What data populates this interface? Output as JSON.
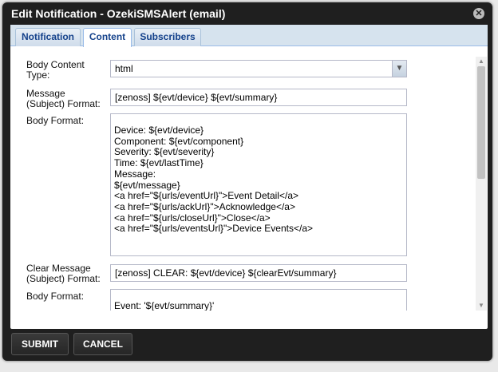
{
  "dialog": {
    "title": "Edit Notification - OzekiSMSAlert (email)",
    "close_icon": "close-icon"
  },
  "tabs": [
    {
      "label": "Notification",
      "active": false
    },
    {
      "label": "Content",
      "active": true
    },
    {
      "label": "Subscribers",
      "active": false
    }
  ],
  "form": {
    "body_content_type_label": "Body Content Type:",
    "body_content_type_value": "html",
    "message_subject_label": "Message (Subject) Format:",
    "message_subject_value": "[zenoss] ${evt/device} ${evt/summary}",
    "body_format_label": "Body Format:",
    "body_format_value": "Device: ${evt/device}\nComponent: ${evt/component}\nSeverity: ${evt/severity}\nTime: ${evt/lastTime}\nMessage:\n${evt/message}\n<a href=\"${urls/eventUrl}\">Event Detail</a>\n<a href=\"${urls/ackUrl}\">Acknowledge</a>\n<a href=\"${urls/closeUrl}\">Close</a>\n<a href=\"${urls/eventsUrl}\">Device Events</a>",
    "clear_subject_label": "Clear Message (Subject) Format:",
    "clear_subject_value": "[zenoss] CLEAR: ${evt/device} ${clearEvt/summary}",
    "clear_body_format_label": "Body Format:",
    "clear_body_format_value": "Event: '${evt/summary}'"
  },
  "footer": {
    "submit_label": "SUBMIT",
    "cancel_label": "CANCEL"
  },
  "colors": {
    "dialog_bg": "#1f1f1f",
    "tab_text": "#15428b",
    "tabstrip_bg": "#d6e3ee"
  }
}
